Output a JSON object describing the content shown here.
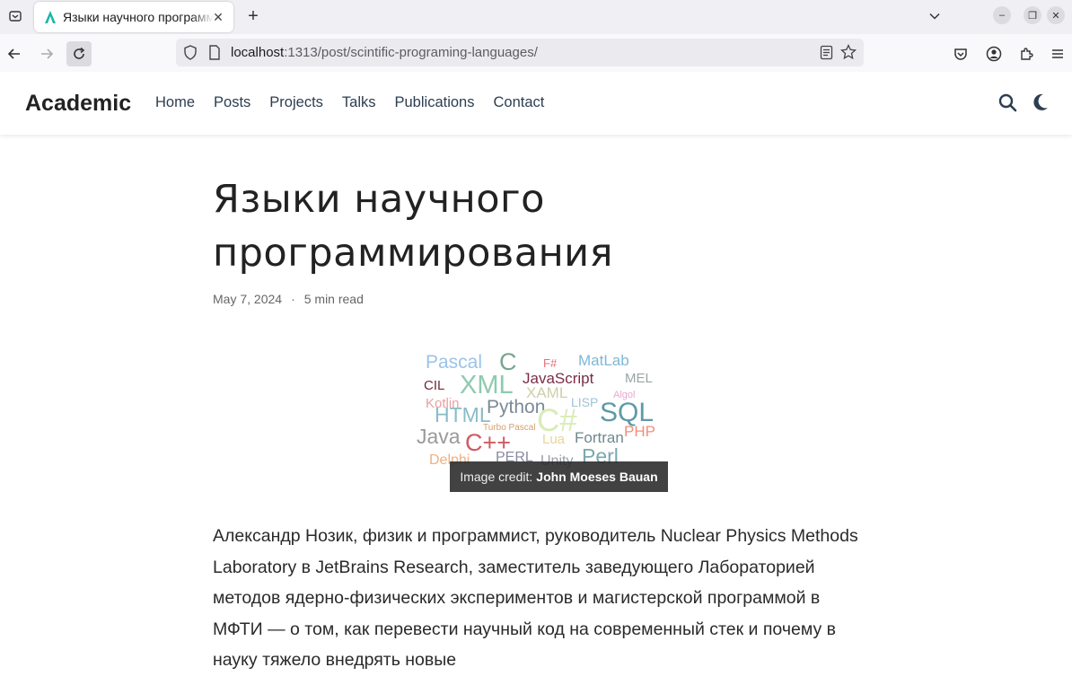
{
  "browser": {
    "tab_title": "Языки научного программирования",
    "url_host": "localhost",
    "url_rest": ":1313/post/scintific-programing-languages/"
  },
  "site": {
    "brand": "Academic",
    "menu": [
      "Home",
      "Posts",
      "Projects",
      "Talks",
      "Publications",
      "Contact"
    ]
  },
  "article": {
    "title": "Языки научного программирования",
    "date": "May 7, 2024",
    "separator": "·",
    "read_time": "5 min read",
    "credit_prefix": "Image credit:",
    "credit_author": "John Moeses Bauan",
    "wordcloud": [
      "Pascal",
      "C",
      "F#",
      "MatLab",
      "CIL",
      "XML",
      "JavaScript",
      "MEL",
      "XAML",
      "Algol",
      "Kotlin",
      "Python",
      "LISP",
      "HTML",
      "C#",
      "SQL",
      "Turbo Pascal",
      "PHP",
      "Java",
      "C++",
      "Lua",
      "Fortran",
      "Delphi",
      "PERL",
      "Unity",
      "Perl"
    ],
    "body": "Александр Нозик, физик и программист, руководитель Nuclear Physics Methods Laboratory в JetBrains Research, заместитель заведующего Лабораторией методов ядерно-физических экспериментов и магистерской программой в МФТИ — о том, как перевести научный код на современный стек и почему в науку тяжело внедрять новые"
  },
  "colors": {
    "accent": "#1565c0",
    "nav_link": "#2c3e50"
  }
}
